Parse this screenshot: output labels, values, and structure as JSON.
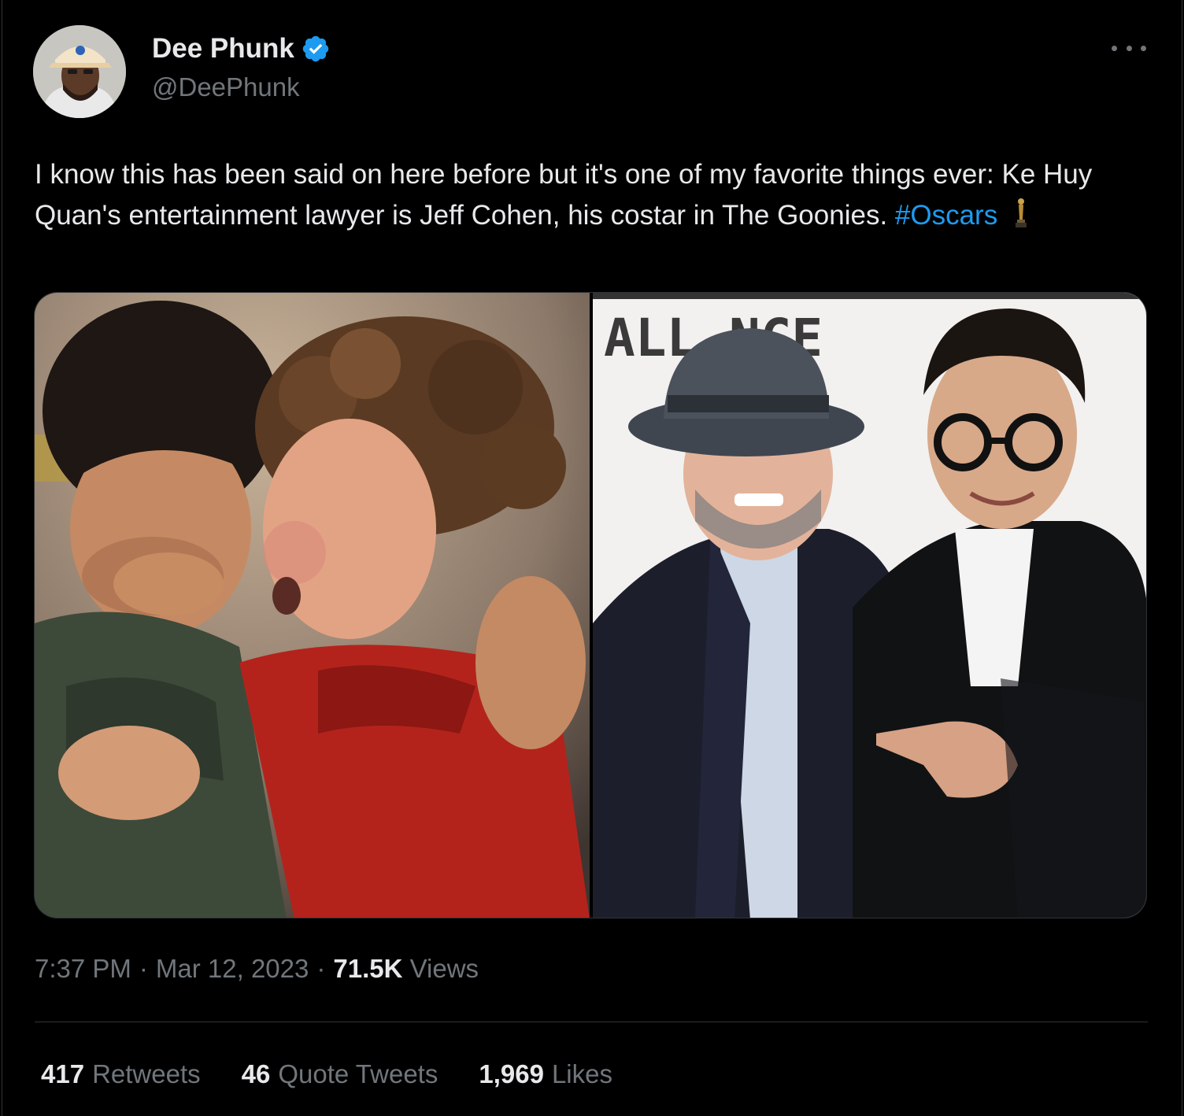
{
  "author": {
    "display_name": "Dee Phunk",
    "handle": "@DeePhunk",
    "verified": true,
    "avatar": "profile-photo"
  },
  "tweet": {
    "text": "I know this has been said on here before but it's one of my favorite things ever: Ke Huy Quan's entertainment lawyer is Jeff Cohen, his costar in The Goonies.",
    "hashtag": "#Oscars",
    "emoji": "oscar-trophy-icon"
  },
  "media": {
    "images": [
      {
        "name": "goonies-still"
      },
      {
        "name": "red-carpet-photo",
        "backdrop_text": "ALL     NCE"
      }
    ]
  },
  "meta": {
    "time": "7:37 PM",
    "separator": "·",
    "date": "Mar 12, 2023",
    "views_count": "71.5K",
    "views_label": "Views"
  },
  "stats": {
    "retweets_count": "417",
    "retweets_label": "Retweets",
    "quotes_count": "46",
    "quotes_label": "Quote Tweets",
    "likes_count": "1,969",
    "likes_label": "Likes"
  },
  "colors": {
    "background": "#000000",
    "text": "#e7e9ea",
    "muted": "#71767b",
    "link": "#1d9bf0",
    "border": "#2f3336"
  }
}
